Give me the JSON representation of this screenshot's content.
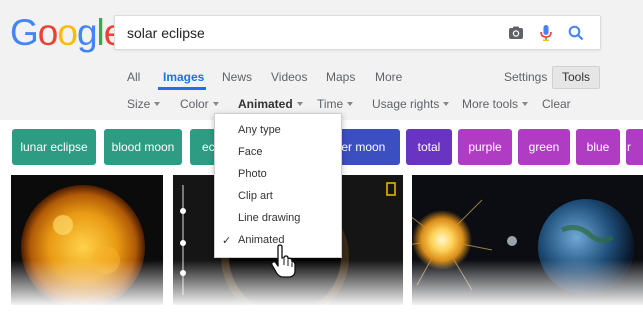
{
  "logo": {
    "letters": [
      "G",
      "o",
      "o",
      "g",
      "l",
      "e"
    ],
    "colors": [
      "#4285F4",
      "#EA4335",
      "#FBBC05",
      "#4285F4",
      "#34A853",
      "#EA4335"
    ]
  },
  "search": {
    "query": "solar eclipse",
    "icons": [
      "camera-icon",
      "microphone-icon",
      "search-icon"
    ],
    "search_icon_color": "#4285F4"
  },
  "tabs": [
    {
      "label": "All"
    },
    {
      "label": "Images",
      "active": true
    },
    {
      "label": "News"
    },
    {
      "label": "Videos"
    },
    {
      "label": "Maps"
    },
    {
      "label": "More"
    }
  ],
  "settings_label": "Settings",
  "tools_label": "Tools",
  "filters": [
    {
      "label": "Size"
    },
    {
      "label": "Color"
    },
    {
      "label": "Animated",
      "active": true
    },
    {
      "label": "Time"
    },
    {
      "label": "Usage rights"
    },
    {
      "label": "More tools"
    },
    {
      "label": "Clear"
    }
  ],
  "chips": [
    {
      "label": "lunar eclipse",
      "color": "#2e9b83"
    },
    {
      "label": "blood moon",
      "color": "#2e9b83"
    },
    {
      "label": "ec",
      "color": "#2e9b83"
    },
    {
      "label": "per moon",
      "color": "#3b4fc0"
    },
    {
      "label": "total",
      "color": "#6a34c2"
    },
    {
      "label": "purple",
      "color": "#b03cc4"
    },
    {
      "label": "green",
      "color": "#b03cc4"
    },
    {
      "label": "blue",
      "color": "#b03cc4"
    },
    {
      "label": "r",
      "color": "#b03cc4"
    }
  ],
  "dropdown": {
    "items": [
      "Any type",
      "Face",
      "Photo",
      "Clip art",
      "Line drawing",
      "Animated"
    ],
    "selected": "Animated"
  },
  "colors": {
    "accent": "#1a73e8"
  }
}
